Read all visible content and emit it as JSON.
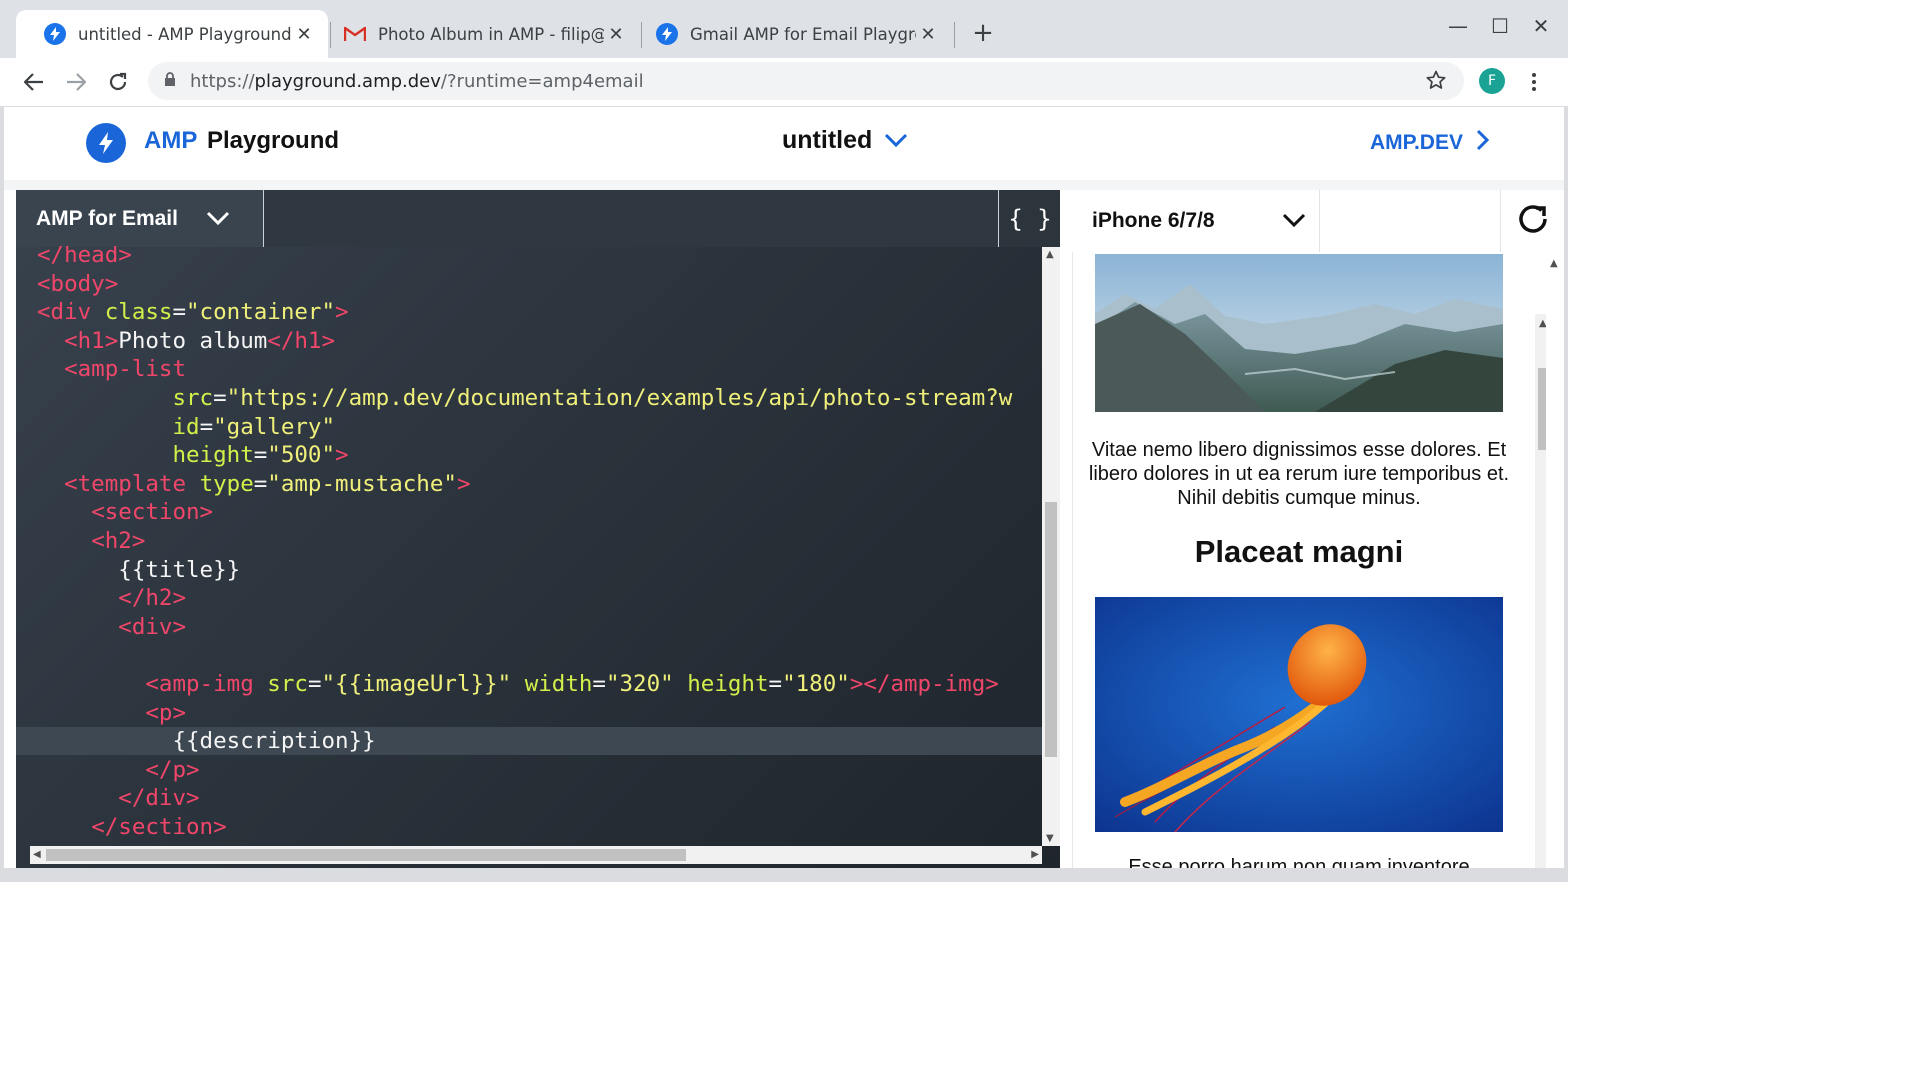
{
  "browser": {
    "tabs": [
      {
        "title": "untitled - AMP Playground",
        "icon": "amp-bolt-icon"
      },
      {
        "title": "Photo Album in AMP - filip@g",
        "icon": "gmail-icon"
      },
      {
        "title": "Gmail AMP for Email Playgro",
        "icon": "amp-bolt-icon"
      }
    ],
    "url": {
      "scheme": "https://",
      "host": "playground.amp.dev",
      "path": "/?runtime=amp4email"
    },
    "profile_initial": "F",
    "accent": "#1a73e8"
  },
  "app": {
    "brand_amp": "AMP",
    "brand_playground": "Playground",
    "doc_title": "untitled",
    "ampdev_link": "AMP.DEV",
    "brand_color": "#1a66d9"
  },
  "editor": {
    "format": "AMP for Email",
    "format_button": "{ }",
    "lines": [
      [
        {
          "c": "t",
          "v": "</head>"
        }
      ],
      [
        {
          "c": "t",
          "v": "<body>"
        }
      ],
      [
        {
          "c": "t",
          "v": "<div "
        },
        {
          "c": "a",
          "v": "class"
        },
        {
          "c": "p",
          "v": "="
        },
        {
          "c": "s",
          "v": "\"container\""
        },
        {
          "c": "t",
          "v": ">"
        }
      ],
      [
        {
          "c": "p",
          "v": "  "
        },
        {
          "c": "t",
          "v": "<h1>"
        },
        {
          "c": "p",
          "v": "Photo album"
        },
        {
          "c": "t",
          "v": "</h1>"
        }
      ],
      [
        {
          "c": "p",
          "v": "  "
        },
        {
          "c": "t",
          "v": "<amp-list"
        }
      ],
      [
        {
          "c": "p",
          "v": "          "
        },
        {
          "c": "a",
          "v": "src"
        },
        {
          "c": "p",
          "v": "="
        },
        {
          "c": "s",
          "v": "\"https://amp.dev/documentation/examples/api/photo-stream?w"
        }
      ],
      [
        {
          "c": "p",
          "v": "          "
        },
        {
          "c": "a",
          "v": "id"
        },
        {
          "c": "p",
          "v": "="
        },
        {
          "c": "s",
          "v": "\"gallery\""
        }
      ],
      [
        {
          "c": "p",
          "v": "          "
        },
        {
          "c": "a",
          "v": "height"
        },
        {
          "c": "p",
          "v": "="
        },
        {
          "c": "s",
          "v": "\"500\""
        },
        {
          "c": "t",
          "v": ">"
        }
      ],
      [
        {
          "c": "p",
          "v": "  "
        },
        {
          "c": "t",
          "v": "<template "
        },
        {
          "c": "a",
          "v": "type"
        },
        {
          "c": "p",
          "v": "="
        },
        {
          "c": "s",
          "v": "\"amp-mustache\""
        },
        {
          "c": "t",
          "v": ">"
        }
      ],
      [
        {
          "c": "p",
          "v": "    "
        },
        {
          "c": "t",
          "v": "<section>"
        }
      ],
      [
        {
          "c": "p",
          "v": "    "
        },
        {
          "c": "t",
          "v": "<h2>"
        }
      ],
      [
        {
          "c": "p",
          "v": "      {{title}}"
        }
      ],
      [
        {
          "c": "p",
          "v": "      "
        },
        {
          "c": "t",
          "v": "</h2>"
        }
      ],
      [
        {
          "c": "p",
          "v": "      "
        },
        {
          "c": "t",
          "v": "<div>"
        }
      ],
      [
        {
          "c": "p",
          "v": ""
        }
      ],
      [
        {
          "c": "p",
          "v": "        "
        },
        {
          "c": "t",
          "v": "<amp-img "
        },
        {
          "c": "a",
          "v": "src"
        },
        {
          "c": "p",
          "v": "="
        },
        {
          "c": "s",
          "v": "\"{{imageUrl}}\" "
        },
        {
          "c": "a",
          "v": "width"
        },
        {
          "c": "p",
          "v": "="
        },
        {
          "c": "s",
          "v": "\"320\" "
        },
        {
          "c": "a",
          "v": "height"
        },
        {
          "c": "p",
          "v": "="
        },
        {
          "c": "s",
          "v": "\"180\""
        },
        {
          "c": "t",
          "v": "></amp-img>"
        }
      ],
      [
        {
          "c": "p",
          "v": "        "
        },
        {
          "c": "t",
          "v": "<p>"
        }
      ],
      [
        {
          "c": "p",
          "v": "          {{description}}"
        }
      ],
      [
        {
          "c": "p",
          "v": "        "
        },
        {
          "c": "t",
          "v": "</p>"
        }
      ],
      [
        {
          "c": "p",
          "v": "      "
        },
        {
          "c": "t",
          "v": "</div>"
        }
      ],
      [
        {
          "c": "p",
          "v": "    "
        },
        {
          "c": "t",
          "v": "</section>"
        }
      ]
    ],
    "highlighted_line": 17,
    "colors": {
      "tag": "#f0466a",
      "attr": "#d2ef4a",
      "string": "#efef7a",
      "text": "#f5f5f5"
    }
  },
  "preview": {
    "device": "iPhone 6/7/8",
    "image1_alt": "mountain-landscape-image",
    "description": "Vitae nemo libero dignissimos esse dolores. Et libero dolores in ut ea rerum iure temporibus et. Nihil debitis cumque minus.",
    "heading": "Placeat magni",
    "image2_alt": "jellyfish-image",
    "next_text": "Esse porro harum non quam inventore"
  }
}
